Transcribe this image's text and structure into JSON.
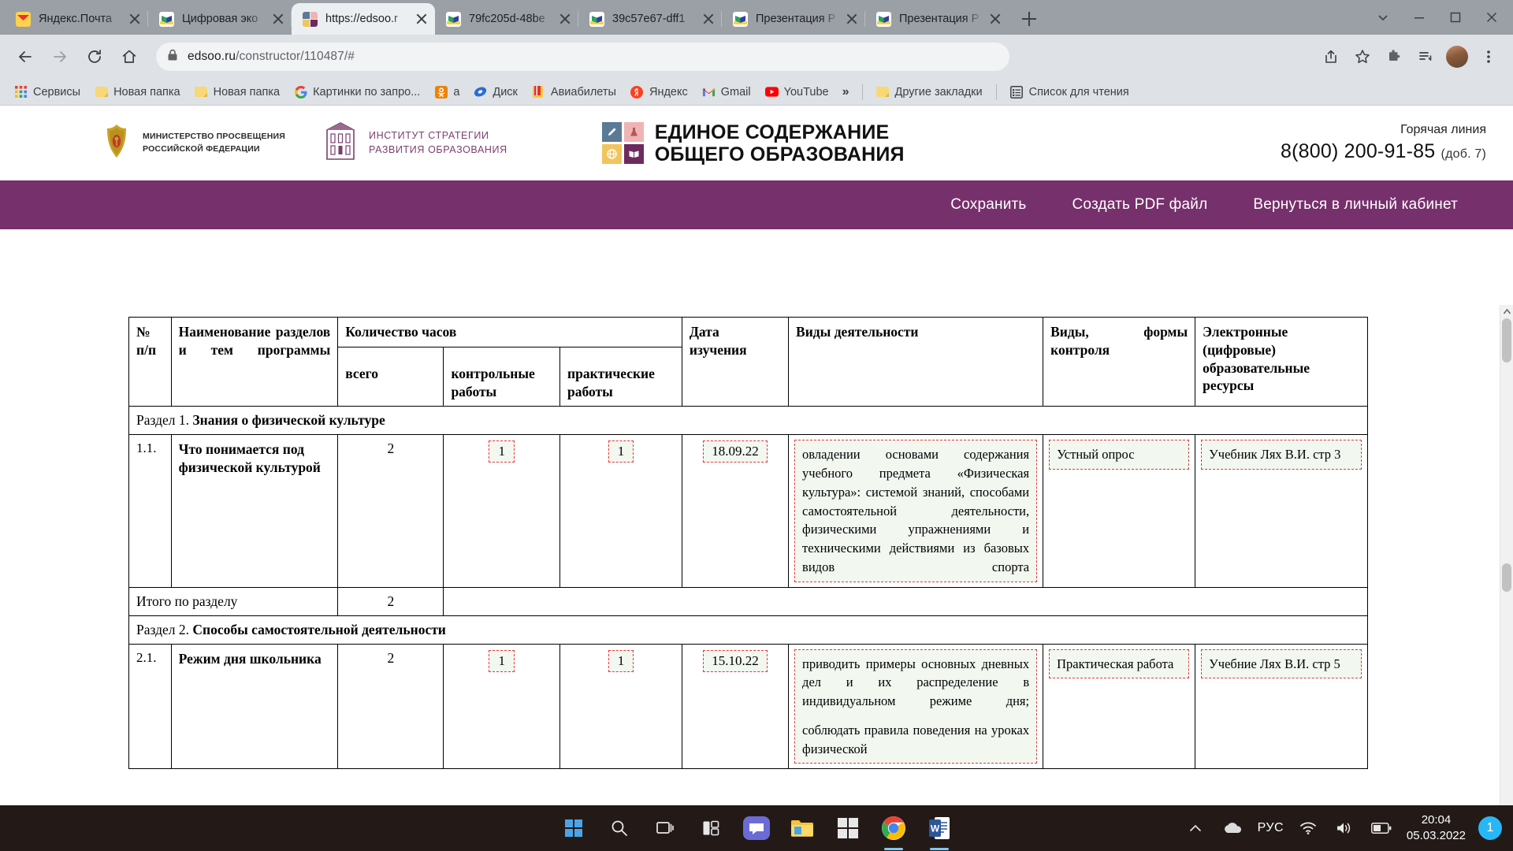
{
  "browser": {
    "tabs": [
      {
        "title": "Яндекс.Почта",
        "favicon": "yandex-mail-icon",
        "active": false
      },
      {
        "title": "Цифровая эко",
        "favicon": "book-icon",
        "active": false
      },
      {
        "title": "https://edsoo.r",
        "favicon": "edsoo-icon",
        "active": true
      },
      {
        "title": "79fc205d-48be",
        "favicon": "book-icon",
        "active": false
      },
      {
        "title": "39c57e67-dff1",
        "favicon": "book-icon",
        "active": false
      },
      {
        "title": "Презентация P",
        "favicon": "book-icon",
        "active": false
      },
      {
        "title": "Презентация P",
        "favicon": "book-icon",
        "active": false
      }
    ],
    "new_tab_label": "+",
    "address": {
      "url_main": "edsoo.ru",
      "url_path": "/constructor/110487/#",
      "lock_icon": "lock-icon"
    },
    "bookmarks": [
      {
        "label": "Сервисы",
        "icon": "apps-grid-icon"
      },
      {
        "label": "Новая папка",
        "icon": "folder-icon"
      },
      {
        "label": "Новая папка",
        "icon": "folder-icon"
      },
      {
        "label": "Картинки по запро...",
        "icon": "google-icon"
      },
      {
        "label": "а",
        "icon": "odnoklassniki-icon"
      },
      {
        "label": "Диск",
        "icon": "disk-icon"
      },
      {
        "label": "Авиабилеты",
        "icon": "tickets-icon"
      },
      {
        "label": "Яндекс",
        "icon": "yandex-icon"
      },
      {
        "label": "Gmail",
        "icon": "gmail-icon"
      },
      {
        "label": "YouTube",
        "icon": "youtube-icon"
      }
    ],
    "bookmarks_overflow": "»",
    "other_bookmarks": {
      "label": "Другие закладки",
      "icon": "folder-icon"
    },
    "reading_list": {
      "label": "Список для чтения",
      "icon": "reading-list-icon"
    }
  },
  "site": {
    "ministry": {
      "line1": "МИНИСТЕРСТВО ПРОСВЕЩЕНИЯ",
      "line2": "РОССИЙСКОЙ ФЕДЕРАЦИИ"
    },
    "institute": {
      "line1": "ИНСТИТУТ СТРАТЕГИИ",
      "line2": "РАЗВИТИЯ ОБРАЗОВАНИЯ"
    },
    "brand": {
      "line1": "ЕДИНОЕ СОДЕРЖАНИЕ",
      "line2": "ОБЩЕГО ОБРАЗОВАНИЯ"
    },
    "hotline": {
      "label": "Горячая линия",
      "phone": "8(800) 200-91-85",
      "ext": "(доб. 7)"
    },
    "actions": {
      "save": "Сохранить",
      "create_pdf": "Создать PDF файл",
      "back_to_account": "Вернуться в личный кабинет"
    },
    "accent_color": "#76306b"
  },
  "table": {
    "headers": {
      "num": "№ п/п",
      "num_l1": "№",
      "num_l2": "п/п",
      "name": "Наименование разделов и тем программы",
      "hours": "Количество часов",
      "hours_total": "всего",
      "hours_control": "контрольные работы",
      "hours_practice": "практические работы",
      "date": "Дата изучения",
      "date_l1": "Дата",
      "date_l2": "изучения",
      "activities": "Виды деятельности",
      "control": "Виды, формы контроля",
      "resources": "Электронные (цифровые) образовательные ресурсы"
    },
    "sections": [
      {
        "label": "Раздел 1.",
        "name": "Знания о физической культуре",
        "rows": [
          {
            "num": "1.1.",
            "name": "Что понимается под физической культурой",
            "total": "2",
            "control": "1",
            "practice": "1",
            "date": "18.09.22",
            "activities": [
              "овладении основами содержания учебного предмета «Физическая культура»: системой знаний, способами самостоятельной деятельности, физическими упражнениями и техническими действиями из базовых видов спорта"
            ],
            "control_form": "Устный опрос",
            "resources": "Учебник Лях В.И. стр 3"
          }
        ],
        "total_label": "Итого по разделу",
        "total_value": "2"
      },
      {
        "label": "Раздел 2.",
        "name": "Способы самостоятельной деятельности",
        "rows": [
          {
            "num": "2.1.",
            "name": "Режим дня школьника",
            "total": "2",
            "control": "1",
            "practice": "1",
            "date": "15.10.22",
            "activities": [
              "приводить примеры основных дневных дел и их распределение в индивидуальном режиме дня;",
              "соблюдать правила поведения на уроках физической"
            ],
            "control_form": "Практическая работа",
            "resources": "Учебние Лях В.И. стр 5"
          }
        ]
      }
    ],
    "field_border_color": "#e03b3b",
    "field_fill_color": "#f2f7f0"
  },
  "taskbar": {
    "items": [
      {
        "icon": "windows-start-icon"
      },
      {
        "icon": "search-icon"
      },
      {
        "icon": "task-view-icon"
      },
      {
        "icon": "widgets-icon"
      },
      {
        "icon": "teams-chat-icon"
      },
      {
        "icon": "file-explorer-icon"
      },
      {
        "icon": "microsoft-store-icon"
      },
      {
        "icon": "chrome-icon"
      },
      {
        "icon": "word-icon"
      }
    ],
    "tray": {
      "expand": "show-hidden-icons",
      "onedrive": "onedrive-icon",
      "language": "РУС",
      "wifi": "wifi-icon",
      "volume": "volume-icon",
      "battery": "battery-icon",
      "time": "20:04",
      "date": "05.03.2022",
      "notification_count": "1"
    }
  }
}
